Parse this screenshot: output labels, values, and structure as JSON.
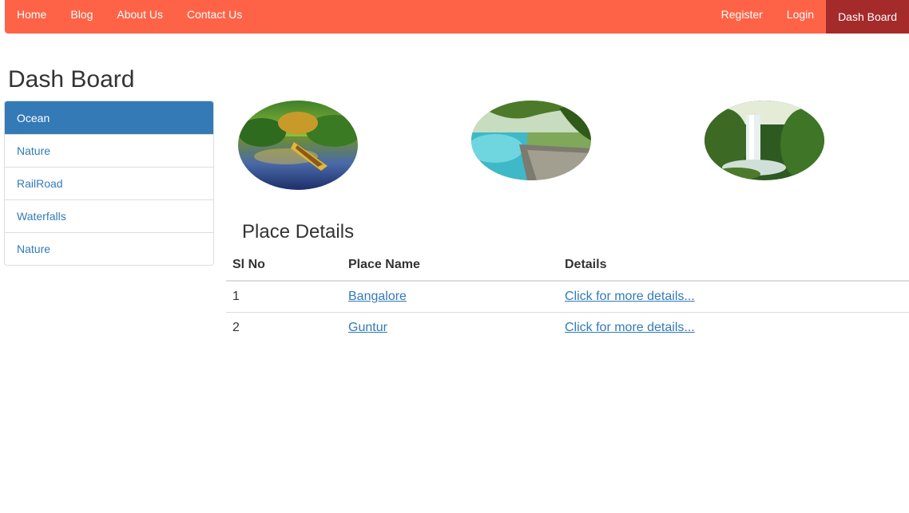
{
  "navbar": {
    "left_items": [
      {
        "label": "Home"
      },
      {
        "label": "Blog"
      },
      {
        "label": "About Us"
      },
      {
        "label": "Contact Us"
      }
    ],
    "right_items": [
      {
        "label": "Register"
      },
      {
        "label": "Login"
      },
      {
        "label": "Dash Board",
        "active": true
      }
    ]
  },
  "page_title": "Dash Board",
  "sidebar": {
    "items": [
      {
        "label": "Ocean",
        "active": true
      },
      {
        "label": "Nature"
      },
      {
        "label": "RailRoad"
      },
      {
        "label": "Waterfalls"
      },
      {
        "label": "Nature"
      }
    ]
  },
  "gallery": [
    {
      "icon": "lake-canoe-image"
    },
    {
      "icon": "forest-boardwalk-image"
    },
    {
      "icon": "waterfall-image"
    }
  ],
  "place_details": {
    "title": "Place Details",
    "columns": [
      "Sl No",
      "Place Name",
      "Details"
    ],
    "rows": [
      {
        "sl_no": "1",
        "place_name": "Bangalore",
        "details": "Click for more details..."
      },
      {
        "sl_no": "2",
        "place_name": "Guntur",
        "details": "Click for more details..."
      }
    ]
  },
  "colors": {
    "navbar_bg": "#ff6347",
    "navbar_active_bg": "#a52a2a",
    "list_active_bg": "#337ab7",
    "link": "#337ab7"
  }
}
